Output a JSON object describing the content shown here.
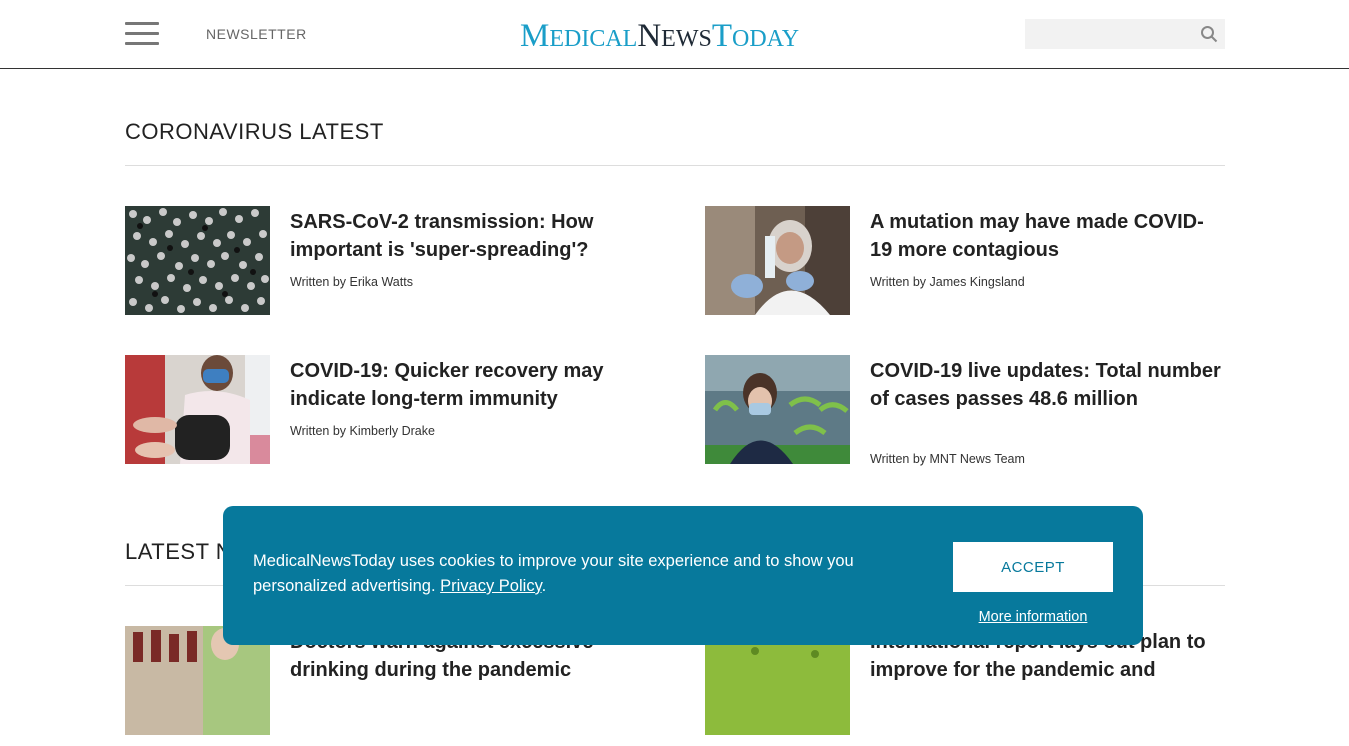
{
  "header": {
    "newsletter_label": "NEWSLETTER",
    "logo": {
      "part1_initial": "M",
      "part1_rest": "EDICAL",
      "part2_initial": "N",
      "part2_rest": "EWS",
      "part3_initial": "T",
      "part3_rest": "ODAY"
    },
    "search": {
      "placeholder": "",
      "icon": "search-icon"
    }
  },
  "coronavirus": {
    "title": "CORONAVIRUS LATEST",
    "articles": [
      {
        "title": "SARS-CoV-2 transmission: How important is 'super-spreading'?",
        "byline": "Written by Erika Watts"
      },
      {
        "title": "A mutation may have made COVID-19 more contagious",
        "byline": "Written by James Kingsland"
      },
      {
        "title": "COVID-19: Quicker recovery may indicate long-term immunity",
        "byline": "Written by Kimberly Drake"
      },
      {
        "title": "COVID-19 live updates: Total number of cases passes 48.6 million",
        "byline": "Written by MNT News Team"
      }
    ]
  },
  "latest_news": {
    "title": "LATEST NEWS",
    "articles": [
      {
        "title": "Doctors warn against excessive drinking during the pandemic"
      },
      {
        "title": "International report lays out plan to improve for the pandemic and"
      }
    ]
  },
  "cookie_banner": {
    "text": "MedicalNewsToday uses cookies to improve your site experience and to show you personalized advertising.",
    "policy_link": "Privacy Policy",
    "after_link": ".",
    "accept_label": "ACCEPT",
    "more_info_label": "More information"
  },
  "colors": {
    "brand_blue": "#1a9ec8",
    "banner_bg": "#07799c"
  }
}
